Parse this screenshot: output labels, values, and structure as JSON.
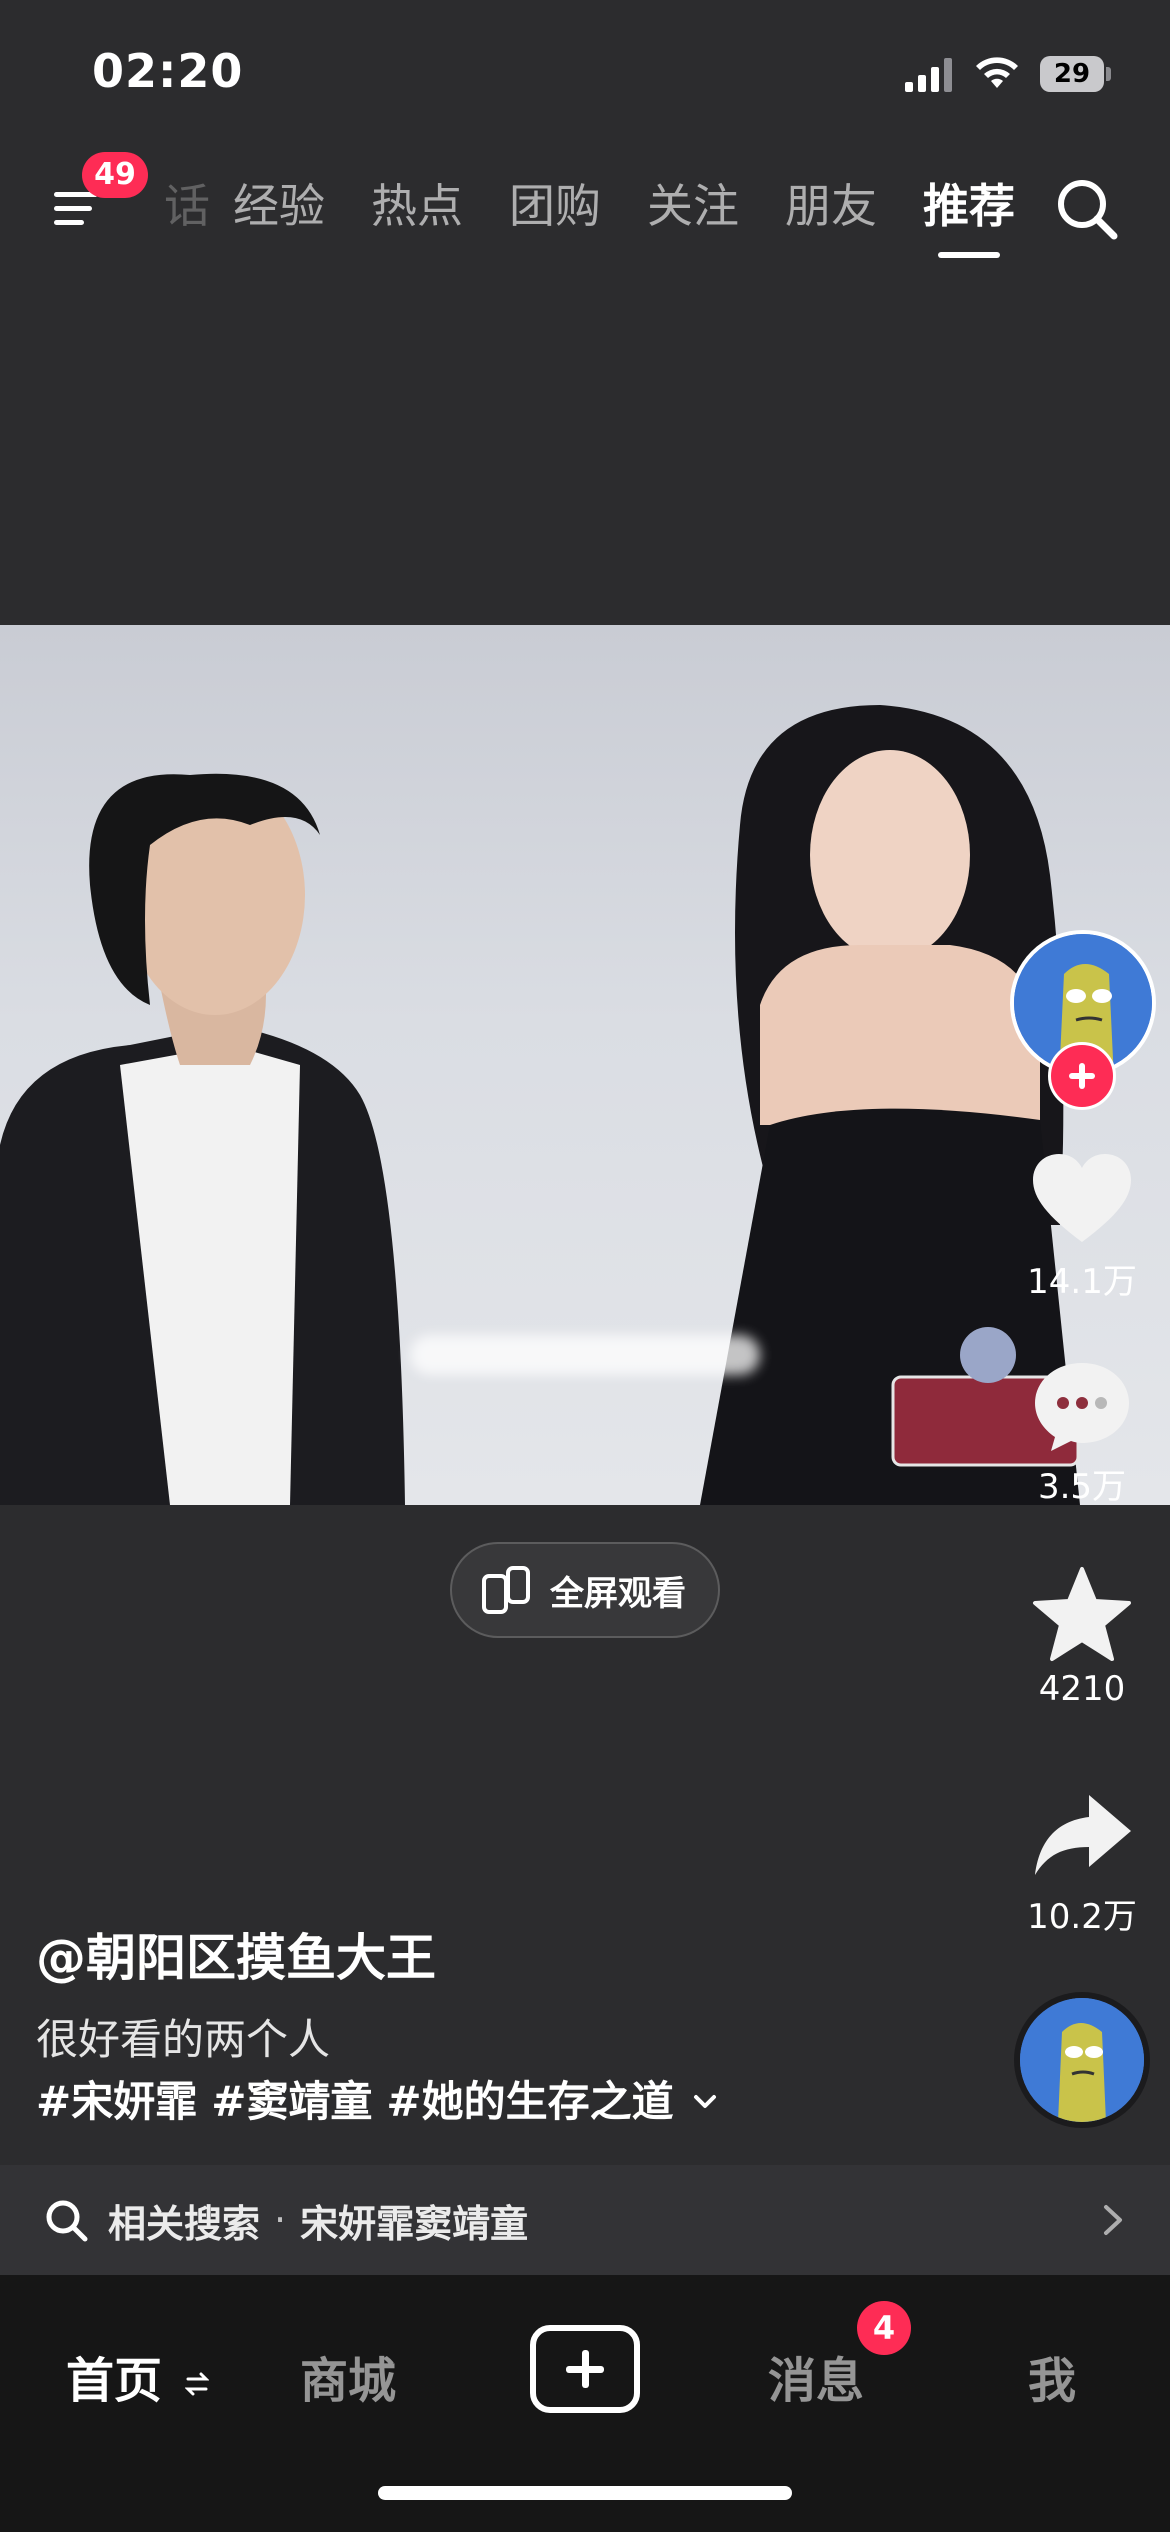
{
  "status_bar": {
    "time": "02:20",
    "battery": "29"
  },
  "top_nav": {
    "menu_badge": "49",
    "partial_tab": "话",
    "tabs": [
      "经验",
      "热点",
      "团购",
      "关注",
      "朋友",
      "推荐"
    ],
    "active_tab": "推荐"
  },
  "video": {
    "fullscreen_label": "全屏观看"
  },
  "actions": {
    "likes": "14.1万",
    "comments": "3.5万",
    "favorites": "4210",
    "shares": "10.2万"
  },
  "post": {
    "author": "@朝阳区摸鱼大王",
    "description": "很好看的两个人",
    "hashtags": [
      "#宋妍霏",
      "#窦靖童",
      "#她的生存之道"
    ]
  },
  "related_search": {
    "label": "相关搜索",
    "separator": "·",
    "query": "宋妍霏窦靖童"
  },
  "bottom_tabs": {
    "home": "首页",
    "mall": "商城",
    "messages": "消息",
    "messages_badge": "4",
    "me": "我"
  },
  "colors": {
    "accent": "#fe2c55",
    "background": "#2c2c2e",
    "tab_bar": "#161616"
  },
  "icons": [
    "menu-icon",
    "search-icon",
    "heart-icon",
    "comment-icon",
    "star-icon",
    "share-icon",
    "rotate-phone-icon",
    "chevron-right-icon",
    "plus-icon"
  ]
}
